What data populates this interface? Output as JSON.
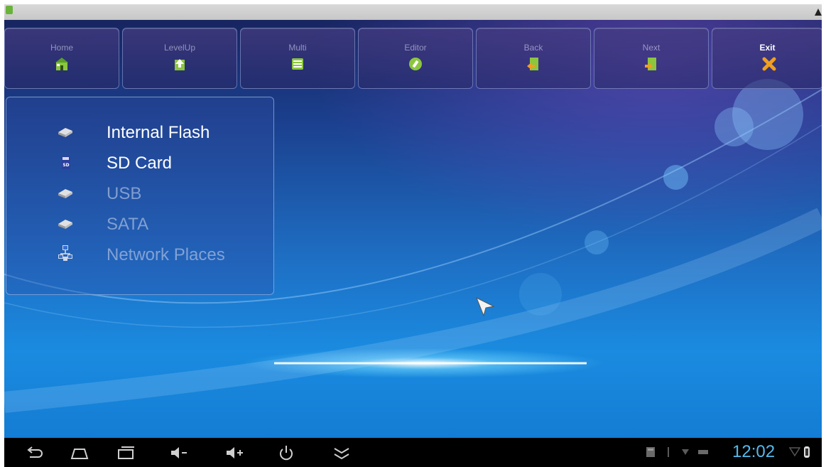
{
  "toolbar": {
    "buttons": [
      {
        "label": "Home",
        "icon": "home-icon"
      },
      {
        "label": "LevelUp",
        "icon": "level-up-icon"
      },
      {
        "label": "Multi",
        "icon": "multi-select-icon"
      },
      {
        "label": "Editor",
        "icon": "editor-icon"
      },
      {
        "label": "Back",
        "icon": "back-icon"
      },
      {
        "label": "Next",
        "icon": "next-icon"
      },
      {
        "label": "Exit",
        "icon": "exit-icon"
      }
    ]
  },
  "storage_panel": {
    "items": [
      {
        "label": "Internal Flash",
        "icon": "drive-icon",
        "enabled": true
      },
      {
        "label": "SD Card",
        "icon": "sd-card-icon",
        "enabled": true
      },
      {
        "label": "USB",
        "icon": "drive-icon",
        "enabled": false
      },
      {
        "label": "SATA",
        "icon": "drive-icon",
        "enabled": false
      },
      {
        "label": "Network Places",
        "icon": "network-icon",
        "enabled": false
      }
    ]
  },
  "navbar": {
    "buttons": [
      "back-nav-icon",
      "home-nav-icon",
      "recents-icon",
      "volume-down-icon",
      "volume-up-icon",
      "power-icon",
      "collapse-icon"
    ],
    "clock": "12:02"
  },
  "colors": {
    "accent_clock": "#56b9ec",
    "exit_icon": "#f0a020",
    "folder_green": "#8cc63e"
  }
}
